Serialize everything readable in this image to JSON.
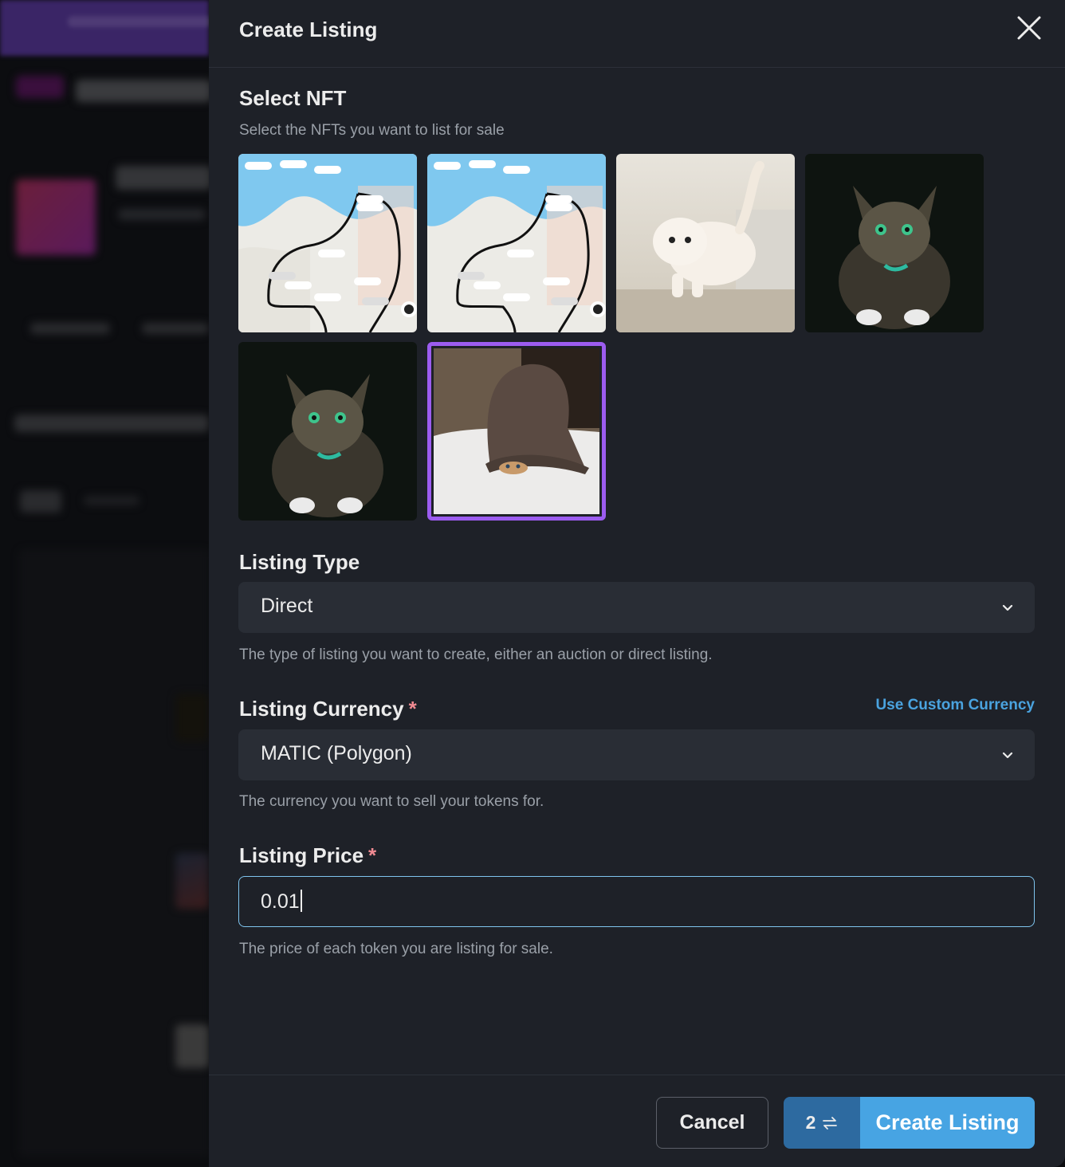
{
  "modal": {
    "title": "Create Listing",
    "close_icon": "close-icon"
  },
  "select_nft": {
    "heading": "Select NFT",
    "subtitle": "Select the NFTs you want to list for sale",
    "items": [
      {
        "depicts": "map with drawn route and AUD price markers",
        "selected": false
      },
      {
        "depicts": "map with drawn route and AUD price markers",
        "selected": false
      },
      {
        "depicts": "white kitten on chair",
        "selected": false
      },
      {
        "depicts": "tabby cat with green eyes",
        "selected": false
      },
      {
        "depicts": "tabby cat with green eyes",
        "selected": false
      },
      {
        "depicts": "kitten hiding under brown bucket hat",
        "selected": true
      }
    ]
  },
  "listing_type": {
    "label": "Listing Type",
    "value": "Direct",
    "help": "The type of listing you want to create, either an auction or direct listing."
  },
  "listing_currency": {
    "label": "Listing Currency",
    "required_mark": "*",
    "custom_link": "Use Custom Currency",
    "value": "MATIC (Polygon)",
    "help": "The currency you want to sell your tokens for."
  },
  "listing_price": {
    "label": "Listing Price",
    "required_mark": "*",
    "value": "0.01",
    "help": "The price of each token you are listing for sale."
  },
  "footer": {
    "cancel_label": "Cancel",
    "tx_count": "2",
    "tx_icon": "swap-arrows-icon",
    "create_label": "Create Listing"
  },
  "colors": {
    "modal_bg": "#1e2128",
    "accent_blue": "#47a4e3",
    "accent_blue_dark": "#2d6aa0",
    "selection_purple": "#9c5cf0",
    "required_red": "#f08a92"
  }
}
